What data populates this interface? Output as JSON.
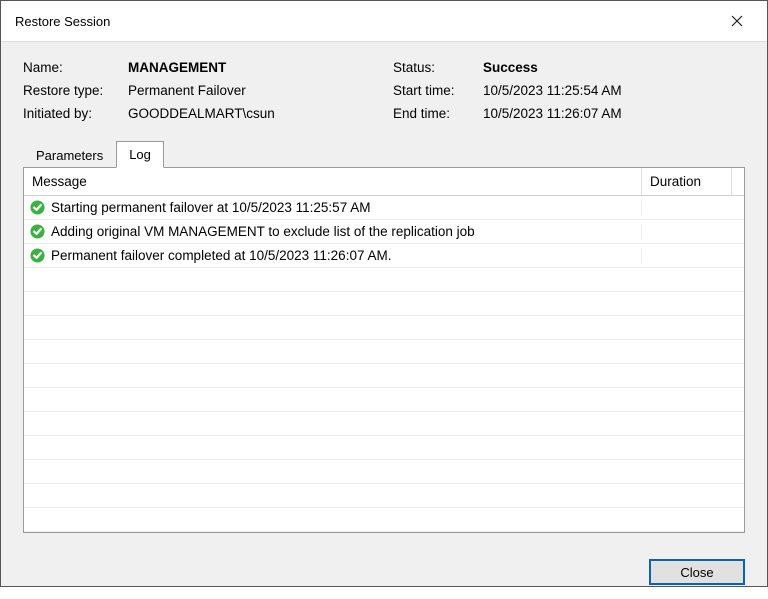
{
  "window": {
    "title": "Restore Session"
  },
  "info": {
    "left": {
      "name_label": "Name:",
      "name_value": "MANAGEMENT",
      "restore_type_label": "Restore type:",
      "restore_type_value": "Permanent Failover",
      "initiated_by_label": "Initiated by:",
      "initiated_by_value": "GOODDEALMART\\csun"
    },
    "right": {
      "status_label": "Status:",
      "status_value": "Success",
      "start_time_label": "Start time:",
      "start_time_value": "10/5/2023 11:25:54 AM",
      "end_time_label": "End time:",
      "end_time_value": "10/5/2023 11:26:07 AM"
    }
  },
  "tabs": {
    "parameters": "Parameters",
    "log": "Log"
  },
  "log": {
    "header_message": "Message",
    "header_duration": "Duration",
    "rows": [
      {
        "status": "success",
        "message": "Starting permanent failover at 10/5/2023 11:25:57 AM",
        "duration": ""
      },
      {
        "status": "success",
        "message": "Adding original VM MANAGEMENT to exclude list of the replication job",
        "duration": ""
      },
      {
        "status": "success",
        "message": "Permanent failover completed at 10/5/2023 11:26:07 AM.",
        "duration": ""
      }
    ],
    "empty_row_count": 11
  },
  "footer": {
    "close_label": "Close"
  }
}
